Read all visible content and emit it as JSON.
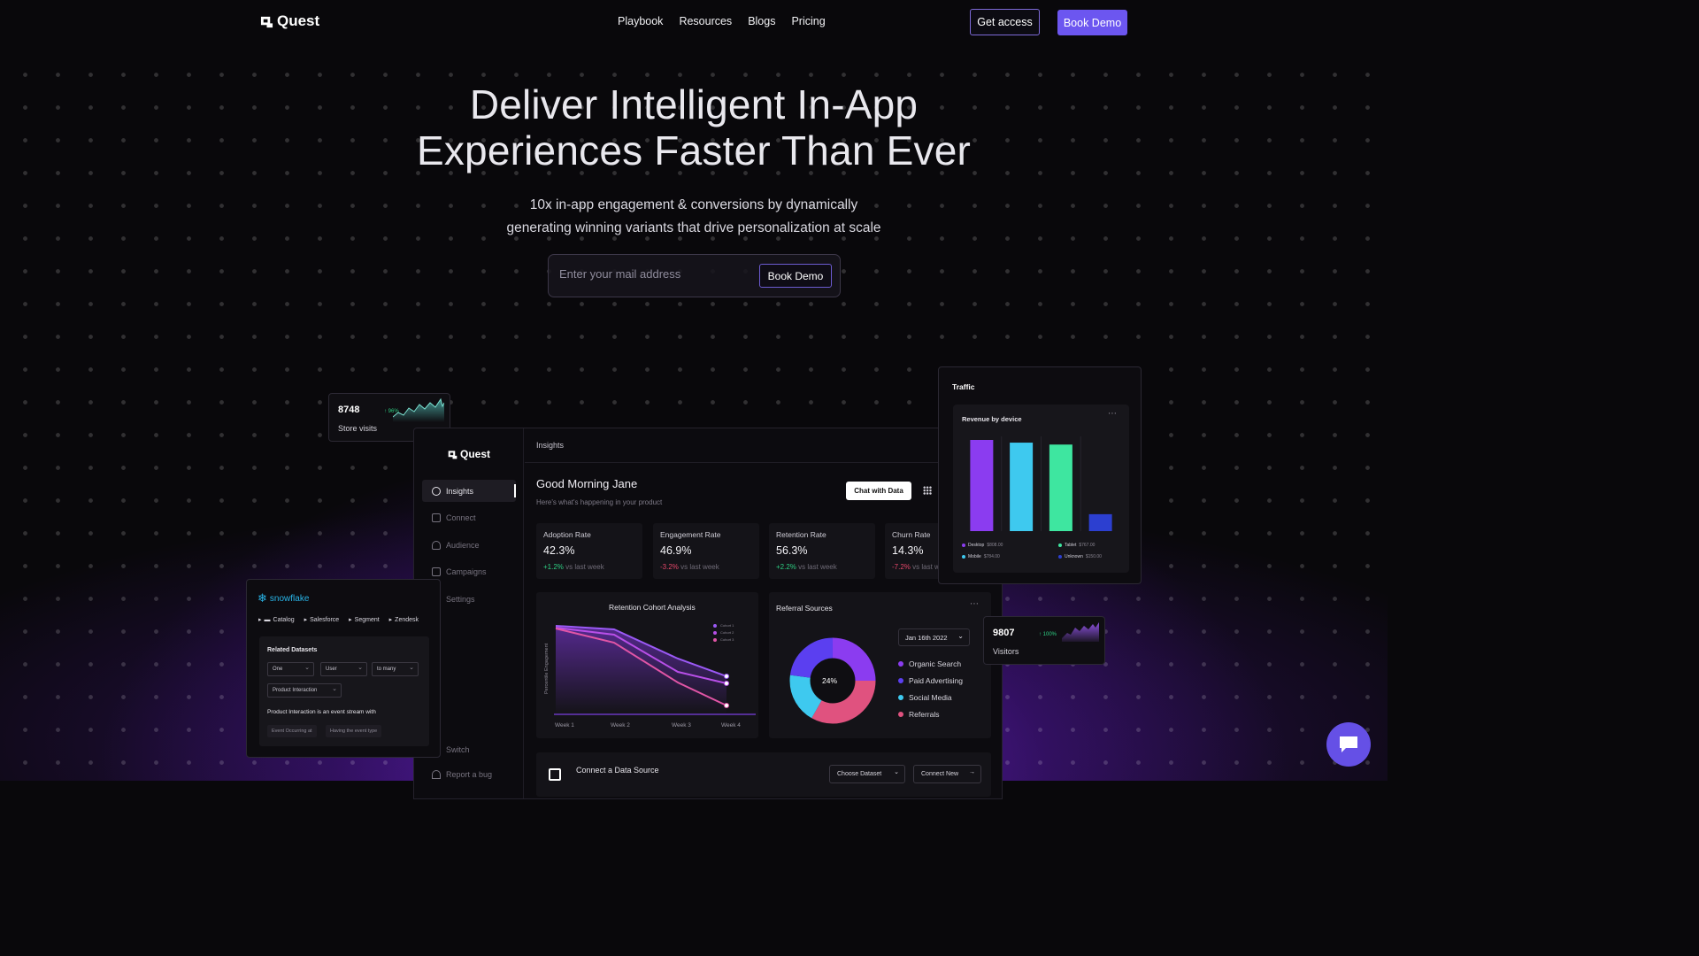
{
  "nav": {
    "brand": "Quest",
    "links": [
      "Playbook",
      "Resources",
      "Blogs",
      "Pricing"
    ],
    "get_access": "Get access",
    "book_demo": "Book Demo"
  },
  "hero": {
    "title_line1": "Deliver Intelligent In-App",
    "title_line2": "Experiences Faster Than Ever",
    "subtitle_line1": "10x in-app engagement & conversions by dynamically",
    "subtitle_line2": "generating winning variants that drive personalization at scale",
    "email_placeholder": "Enter your mail address",
    "cta": "Book Demo"
  },
  "dashboard": {
    "brand": "Quest",
    "sidebar": [
      "Insights",
      "Connect",
      "Audience",
      "Campaigns",
      "Settings"
    ],
    "sidebar_bottom": [
      "Switch",
      "Report a bug"
    ],
    "breadcrumb": "Insights",
    "greeting": "Good Morning Jane",
    "greeting_sub": "Here's what's happening in your product",
    "chat_button": "Chat with Data",
    "metrics": [
      {
        "label": "Adoption Rate",
        "value": "42.3%",
        "delta": "+1.2%",
        "suffix": "vs last week",
        "trend": "up"
      },
      {
        "label": "Engagement Rate",
        "value": "46.9%",
        "delta": "-3.2%",
        "suffix": "vs last week",
        "trend": "down"
      },
      {
        "label": "Retention Rate",
        "value": "56.3%",
        "delta": "+2.2%",
        "suffix": "vs last week",
        "trend": "up"
      },
      {
        "label": "Churn Rate",
        "value": "14.3%",
        "delta": "-7.2%",
        "suffix": "vs last week",
        "trend": "down"
      }
    ],
    "retention": {
      "title": "Retention Cohort Analysis",
      "ylabel": "Percentile Engagement",
      "weeks": [
        "Week 1",
        "Week 2",
        "Week 3",
        "Week 4"
      ],
      "legend": [
        "Cohort 1",
        "Cohort 2",
        "Cohort 3"
      ]
    },
    "referral": {
      "title": "Referral Sources",
      "date": "Jan 16th 2022",
      "center_label": "24%",
      "sources": [
        {
          "name": "Organic Search",
          "color": "#8b3cf0"
        },
        {
          "name": "Paid Advertising",
          "color": "#5b3ff0"
        },
        {
          "name": "Social Media",
          "color": "#3ec9ef"
        },
        {
          "name": "Referrals",
          "color": "#e0527f"
        }
      ]
    },
    "connect": {
      "title": "Connect a Data Source",
      "choose": "Choose Dataset",
      "connect_new": "Connect New"
    }
  },
  "store_card": {
    "value": "8748",
    "label": "Store visits",
    "change": "↑ 96%"
  },
  "visitors_card": {
    "value": "9807",
    "label": "Visitors",
    "change": "↑ 100%"
  },
  "traffic": {
    "title": "Traffic",
    "card_title": "Revenue by device",
    "legend": [
      {
        "name": "Desktop",
        "amount": "$808.00",
        "color": "#8b3cf0"
      },
      {
        "name": "Tablet",
        "amount": "$767.00",
        "color": "#3ee6a0"
      },
      {
        "name": "Mobile",
        "amount": "$784.00",
        "color": "#3ec9ef"
      },
      {
        "name": "Unknown",
        "amount": "$150.00",
        "color": "#2c3fd0"
      }
    ]
  },
  "chart_data": {
    "type": "bar",
    "title": "Revenue by device",
    "categories": [
      "Desktop",
      "Mobile",
      "Tablet",
      "Unknown"
    ],
    "values": [
      808,
      784,
      767,
      150
    ],
    "colors": [
      "#8b3cf0",
      "#3ec9ef",
      "#3ee6a0",
      "#2c3fd0"
    ]
  },
  "snowflake": {
    "brand": "snowflake",
    "path": [
      "Catalog",
      "Salesforce",
      "Segment",
      "Zendesk"
    ],
    "section": "Related Datasets",
    "selects": [
      "One",
      "User",
      "to many",
      "Product Interaction"
    ],
    "note": "Product Interaction is an event stream with",
    "chips": [
      "Event Occurring at",
      "Having the event type"
    ]
  },
  "colors": {
    "accent": "#6c56f0",
    "background": "#09080b"
  }
}
